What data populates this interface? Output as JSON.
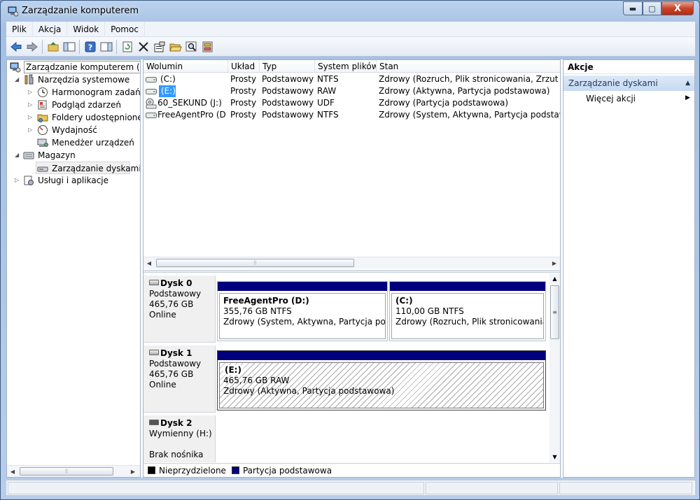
{
  "window": {
    "title": "Zarządzanie komputerem",
    "min_label": "▬",
    "max_label": "▢",
    "close_label": "X"
  },
  "menu": [
    "Plik",
    "Akcja",
    "Widok",
    "Pomoc"
  ],
  "toolbar": [
    "back-icon",
    "forward-icon",
    "up-folder-icon",
    "show-hide-tree-icon",
    "help-icon",
    "show-hide-action-pane-icon",
    "refresh-icon",
    "delete-icon",
    "properties-icon",
    "open-icon",
    "search-icon",
    "export-icon"
  ],
  "tree": {
    "root": "Zarządzanie komputerem (lokalne)",
    "system_tools": "Narzędzia systemowe",
    "task_scheduler": "Harmonogram zadań",
    "event_viewer": "Podgląd zdarzeń",
    "shared_folders": "Foldery udostępnione",
    "performance": "Wydajność",
    "device_manager": "Menedżer urządzeń",
    "storage": "Magazyn",
    "disk_management": "Zarządzanie dyskami",
    "services": "Usługi i aplikacje"
  },
  "volumes": {
    "headers": [
      "Wolumin",
      "Układ",
      "Typ",
      "System plików",
      "Stan"
    ],
    "rows": [
      {
        "name": "(C:)",
        "layout": "Prosty",
        "type": "Podstawowy",
        "fs": "NTFS",
        "status": "Zdrowy (Rozruch, Plik stronicowania, Zrzut awaryjny"
      },
      {
        "name": "(E:)",
        "layout": "Prosty",
        "type": "Podstawowy",
        "fs": "RAW",
        "status": "Zdrowy (Aktywna, Partycja podstawowa)"
      },
      {
        "name": "60_SEKUND (J:)",
        "layout": "Prosty",
        "type": "Podstawowy",
        "fs": "UDF",
        "status": "Zdrowy (Partycja podstawowa)"
      },
      {
        "name": "FreeAgentPro (D:)",
        "layout": "Prosty",
        "type": "Podstawowy",
        "fs": "NTFS",
        "status": "Zdrowy (System, Aktywna, Partycja podstawowa)"
      }
    ]
  },
  "disks": [
    {
      "name": "Dysk 0",
      "type": "Podstawowy",
      "size": "465,76 GB",
      "state": "Online",
      "partitions": [
        {
          "name": "FreeAgentPro  (D:)",
          "size": "355,76 GB NTFS",
          "status": "Zdrowy (System, Aktywna, Partycja podstawowa)"
        },
        {
          "name": "(C:)",
          "size": "110,00 GB NTFS",
          "status": "Zdrowy (Rozruch, Plik stronicowania, Zrzut awaryjny)"
        }
      ]
    },
    {
      "name": "Dysk 1",
      "type": "Podstawowy",
      "size": "465,76 GB",
      "state": "Online",
      "partitions": [
        {
          "name": "(E:)",
          "size": "465,76 GB RAW",
          "status": "Zdrowy (Aktywna, Partycja podstawowa)"
        }
      ]
    },
    {
      "name": "Dysk 2",
      "type": "Wymienny (H:)",
      "size": "",
      "state": "Brak nośnika",
      "partitions": []
    }
  ],
  "legend": {
    "unallocated": "Nieprzydzielone",
    "primary": "Partycja podstawowa",
    "unallocated_color": "#000000",
    "primary_color": "#00007c"
  },
  "actions": {
    "header": "Akcje",
    "section": "Zarządzanie dyskami",
    "more": "Więcej akcji"
  },
  "colors": {
    "selection": "#3399ff",
    "partition_bar": "#00007c"
  }
}
